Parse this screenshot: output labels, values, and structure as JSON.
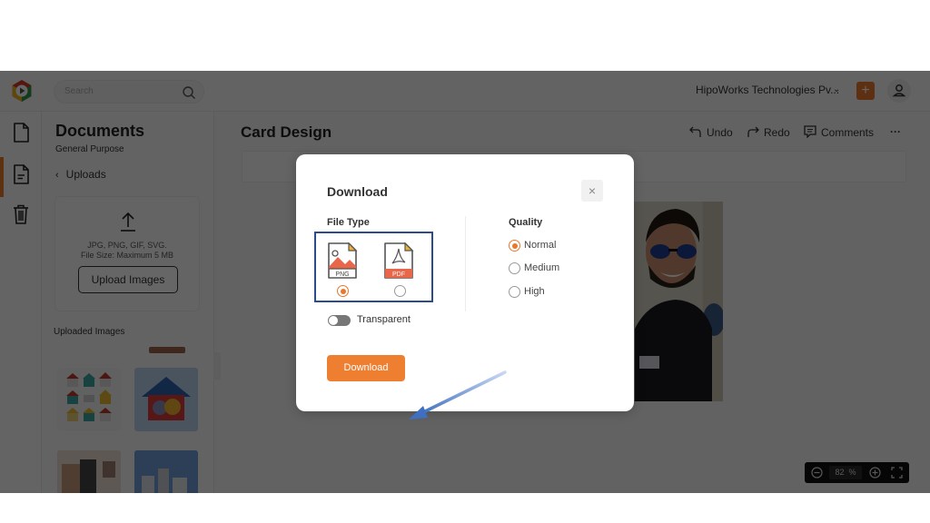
{
  "topbar": {
    "search_placeholder": "Search",
    "organization": "HipoWorks Technologies Pv...",
    "add_label": "+"
  },
  "rail": {
    "items": [
      {
        "icon": "document-icon",
        "active": false
      },
      {
        "icon": "text-document-icon",
        "active": true
      },
      {
        "icon": "trash-icon",
        "active": false
      }
    ]
  },
  "documents_panel": {
    "title": "Documents",
    "subtitle": "General Purpose",
    "back_label": "Uploads",
    "upload_formats": "JPG, PNG, GIF, SVG.",
    "upload_size": "File Size: Maximum 5 MB",
    "upload_button": "Upload Images",
    "uploaded_label": "Uploaded Images",
    "thumbnails": [
      "houses-set",
      "pets-doghouse",
      "people-photo",
      "city-buildings"
    ]
  },
  "editor": {
    "title": "Card Design",
    "undo": "Undo",
    "redo": "Redo",
    "comments": "Comments",
    "more": "···",
    "zoom_value": "82",
    "zoom_unit": "%"
  },
  "modal": {
    "title": "Download",
    "close": "×",
    "file_type_label": "File Type",
    "file_types": [
      {
        "label": "PNG",
        "selected": true
      },
      {
        "label": "PDF",
        "selected": false
      }
    ],
    "transparent_label": "Transparent",
    "transparent_on": false,
    "quality_label": "Quality",
    "quality_options": [
      {
        "label": "Normal",
        "selected": true
      },
      {
        "label": "Medium",
        "selected": false
      },
      {
        "label": "High",
        "selected": false
      }
    ],
    "download_button": "Download"
  },
  "colors": {
    "accent": "#e8782d",
    "highlight_box": "#2b4b8a",
    "annotation_arrow": "#4a7cc9"
  }
}
